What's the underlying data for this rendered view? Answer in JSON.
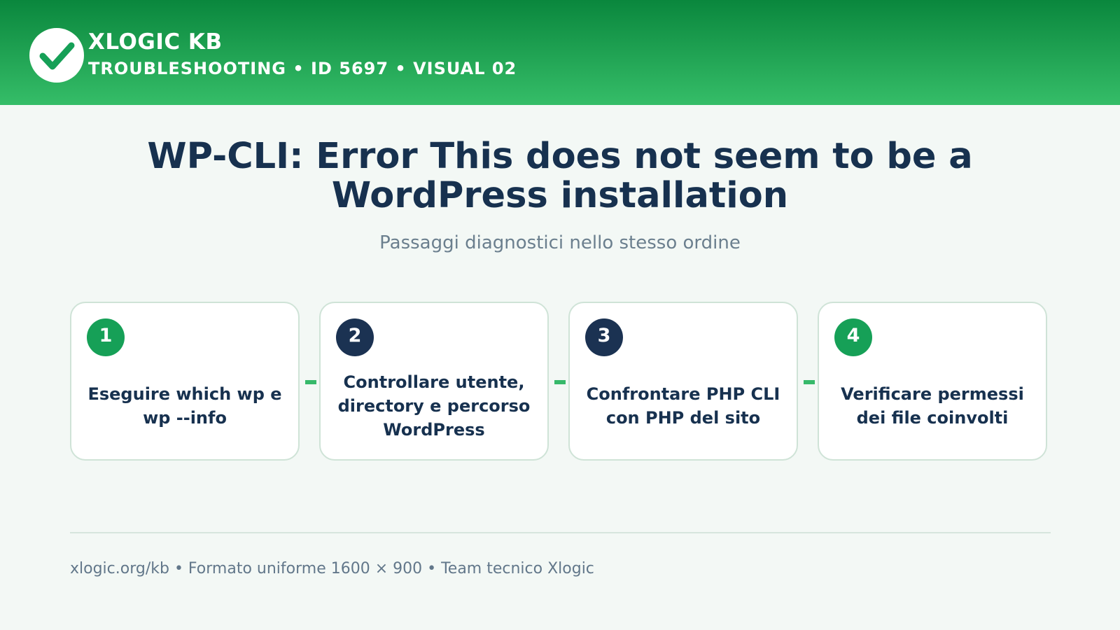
{
  "colors": {
    "header_top": "#0a873d",
    "header_bottom": "#35bd68",
    "accent_green": "#16a057",
    "navy": "#1b3252",
    "background": "#f3f8f5"
  },
  "header": {
    "logo_icon": "checkmark-icon",
    "brand": "XLOGIC KB",
    "subtitle": "TROUBLESHOOTING • ID 5697 • VISUAL 02"
  },
  "main": {
    "title": "WP-CLI: Error This does not seem to be a WordPress installation",
    "subtitle": "Passaggi diagnostici nello stesso ordine"
  },
  "steps": [
    {
      "number": "1",
      "text": "Eseguire which wp e wp --info",
      "badge_color": "#16a057"
    },
    {
      "number": "2",
      "text": "Controllare utente, directory e percorso WordPress",
      "badge_color": "#1b3252"
    },
    {
      "number": "3",
      "text": "Confrontare PHP CLI con PHP del sito",
      "badge_color": "#1b3252"
    },
    {
      "number": "4",
      "text": "Verificare permessi dei file coinvolti",
      "badge_color": "#16a057"
    }
  ],
  "footer": {
    "text": "xlogic.org/kb • Formato uniforme 1600 × 900 • Team tecnico Xlogic"
  }
}
